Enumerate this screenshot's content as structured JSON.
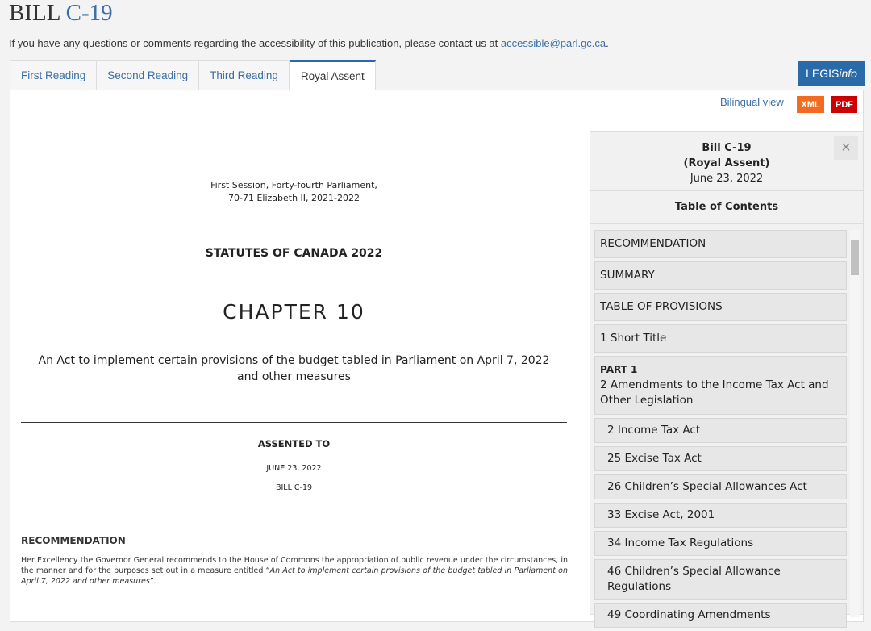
{
  "header": {
    "title_prefix": "BILL",
    "title_number": "C-19",
    "access_text": "If you have any questions or comments regarding the accessibility of this publication, please contact us at ",
    "access_email": "accessible@parl.gc.ca",
    "access_end": "."
  },
  "tabs": [
    {
      "label": "First Reading"
    },
    {
      "label": "Second Reading"
    },
    {
      "label": "Third Reading"
    },
    {
      "label": "Royal Assent",
      "active": true
    }
  ],
  "legisinfo": {
    "a": "LEGIS",
    "b": "info"
  },
  "toolbar": {
    "bilingual": "Bilingual view",
    "xml": "XML",
    "pdf": "PDF"
  },
  "document": {
    "session1": "First Session, Forty-fourth Parliament,",
    "session2": "70-71 Elizabeth II, 2021-2022",
    "statutes": "STATUTES OF CANADA 2022",
    "chapter": "CHAPTER 10",
    "act1": "An Act to implement certain provisions of the budget tabled in Parliament on April 7, 2022",
    "act2": "and other measures",
    "assented": "ASSENTED TO",
    "date": "JUNE 23, 2022",
    "bill": "BILL C-19",
    "rec_heading": "RECOMMENDATION",
    "rec_text": "Her Excellency the Governor General recommends to the House of Commons the appropriation of public revenue under the circumstances, in the manner and for the purposes set out in a measure entitled “",
    "rec_italic": "An Act to implement certain provisions of the budget tabled in Parliament on April 7, 2022 and other measures",
    "rec_end": "”."
  },
  "sidebar": {
    "bill": "Bill C-19",
    "stage": "(Royal Assent)",
    "date": "June 23, 2022",
    "toc_title": "Table of Contents",
    "close": "×",
    "items": [
      {
        "label": "RECOMMENDATION"
      },
      {
        "label": "SUMMARY"
      },
      {
        "label": "TABLE OF PROVISIONS"
      },
      {
        "label": "1 Short Title"
      },
      {
        "part": "PART 1",
        "label": "2 Amendments to the Income Tax Act and Other Legislation"
      },
      {
        "label": "2 Income Tax Act",
        "sub": true
      },
      {
        "label": "25 Excise Tax Act",
        "sub": true
      },
      {
        "label": "26 Children’s Special Allowances Act",
        "sub": true
      },
      {
        "label": "33 Excise Act, 2001",
        "sub": true
      },
      {
        "label": "34 Income Tax Regulations",
        "sub": true
      },
      {
        "label": "46 Children’s Special Allowance Regulations",
        "sub": true
      },
      {
        "label": "49 Coordinating Amendments",
        "sub": true
      }
    ]
  },
  "colors": {
    "link": "#3b6ea5",
    "accent": "#2b6aa8",
    "xml": "#f26b21",
    "pdf": "#cc0000"
  }
}
